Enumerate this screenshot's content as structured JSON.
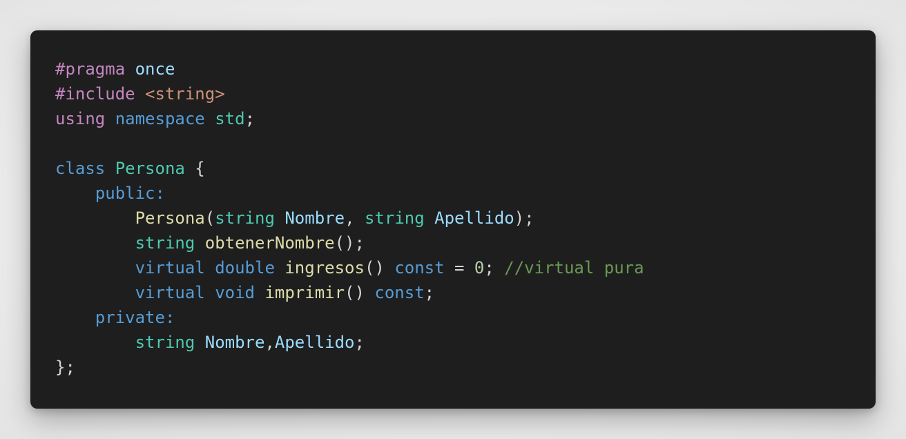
{
  "editor": {
    "theme": {
      "background": "#1e1e1e",
      "page_background": "#ececec",
      "default_text": "#d4d4d4",
      "preprocessor": "#c586c0",
      "keyword": "#569cd6",
      "type": "#4ec9b0",
      "function": "#dcdcaa",
      "variable": "#9cdcfe",
      "string": "#ce9178",
      "number": "#b5cea8",
      "comment": "#6a9955"
    },
    "lines": [
      [
        {
          "t": "#pragma",
          "c": "preproc"
        },
        {
          "t": " ",
          "c": "punct"
        },
        {
          "t": "once",
          "c": "macro"
        }
      ],
      [
        {
          "t": "#include",
          "c": "preproc"
        },
        {
          "t": " ",
          "c": "punct"
        },
        {
          "t": "<string>",
          "c": "string"
        }
      ],
      [
        {
          "t": "using",
          "c": "control"
        },
        {
          "t": " ",
          "c": "punct"
        },
        {
          "t": "namespace",
          "c": "keyword"
        },
        {
          "t": " ",
          "c": "punct"
        },
        {
          "t": "std",
          "c": "type"
        },
        {
          "t": ";",
          "c": "punct"
        }
      ],
      [],
      [
        {
          "t": "class",
          "c": "keyword"
        },
        {
          "t": " ",
          "c": "punct"
        },
        {
          "t": "Persona",
          "c": "type"
        },
        {
          "t": " {",
          "c": "punct"
        }
      ],
      [
        {
          "t": "    ",
          "c": "punct"
        },
        {
          "t": "public:",
          "c": "keyword"
        }
      ],
      [
        {
          "t": "        ",
          "c": "punct"
        },
        {
          "t": "Persona",
          "c": "func"
        },
        {
          "t": "(",
          "c": "punct"
        },
        {
          "t": "string",
          "c": "type"
        },
        {
          "t": " ",
          "c": "punct"
        },
        {
          "t": "Nombre",
          "c": "var"
        },
        {
          "t": ", ",
          "c": "punct"
        },
        {
          "t": "string",
          "c": "type"
        },
        {
          "t": " ",
          "c": "punct"
        },
        {
          "t": "Apellido",
          "c": "var"
        },
        {
          "t": ");",
          "c": "punct"
        }
      ],
      [
        {
          "t": "        ",
          "c": "punct"
        },
        {
          "t": "string",
          "c": "type"
        },
        {
          "t": " ",
          "c": "punct"
        },
        {
          "t": "obtenerNombre",
          "c": "func"
        },
        {
          "t": "();",
          "c": "punct"
        }
      ],
      [
        {
          "t": "        ",
          "c": "punct"
        },
        {
          "t": "virtual",
          "c": "keyword"
        },
        {
          "t": " ",
          "c": "punct"
        },
        {
          "t": "double",
          "c": "keyword"
        },
        {
          "t": " ",
          "c": "punct"
        },
        {
          "t": "ingresos",
          "c": "func"
        },
        {
          "t": "() ",
          "c": "punct"
        },
        {
          "t": "const",
          "c": "keyword"
        },
        {
          "t": " = ",
          "c": "punct"
        },
        {
          "t": "0",
          "c": "number"
        },
        {
          "t": "; ",
          "c": "punct"
        },
        {
          "t": "//virtual pura",
          "c": "comment"
        }
      ],
      [
        {
          "t": "        ",
          "c": "punct"
        },
        {
          "t": "virtual",
          "c": "keyword"
        },
        {
          "t": " ",
          "c": "punct"
        },
        {
          "t": "void",
          "c": "keyword"
        },
        {
          "t": " ",
          "c": "punct"
        },
        {
          "t": "imprimir",
          "c": "func"
        },
        {
          "t": "() ",
          "c": "punct"
        },
        {
          "t": "const",
          "c": "keyword"
        },
        {
          "t": ";",
          "c": "punct"
        }
      ],
      [
        {
          "t": "    ",
          "c": "punct"
        },
        {
          "t": "private:",
          "c": "keyword"
        }
      ],
      [
        {
          "t": "        ",
          "c": "punct"
        },
        {
          "t": "string",
          "c": "type"
        },
        {
          "t": " ",
          "c": "punct"
        },
        {
          "t": "Nombre",
          "c": "var"
        },
        {
          "t": ",",
          "c": "punct"
        },
        {
          "t": "Apellido",
          "c": "var"
        },
        {
          "t": ";",
          "c": "punct"
        }
      ],
      [
        {
          "t": "};",
          "c": "punct"
        }
      ]
    ]
  }
}
